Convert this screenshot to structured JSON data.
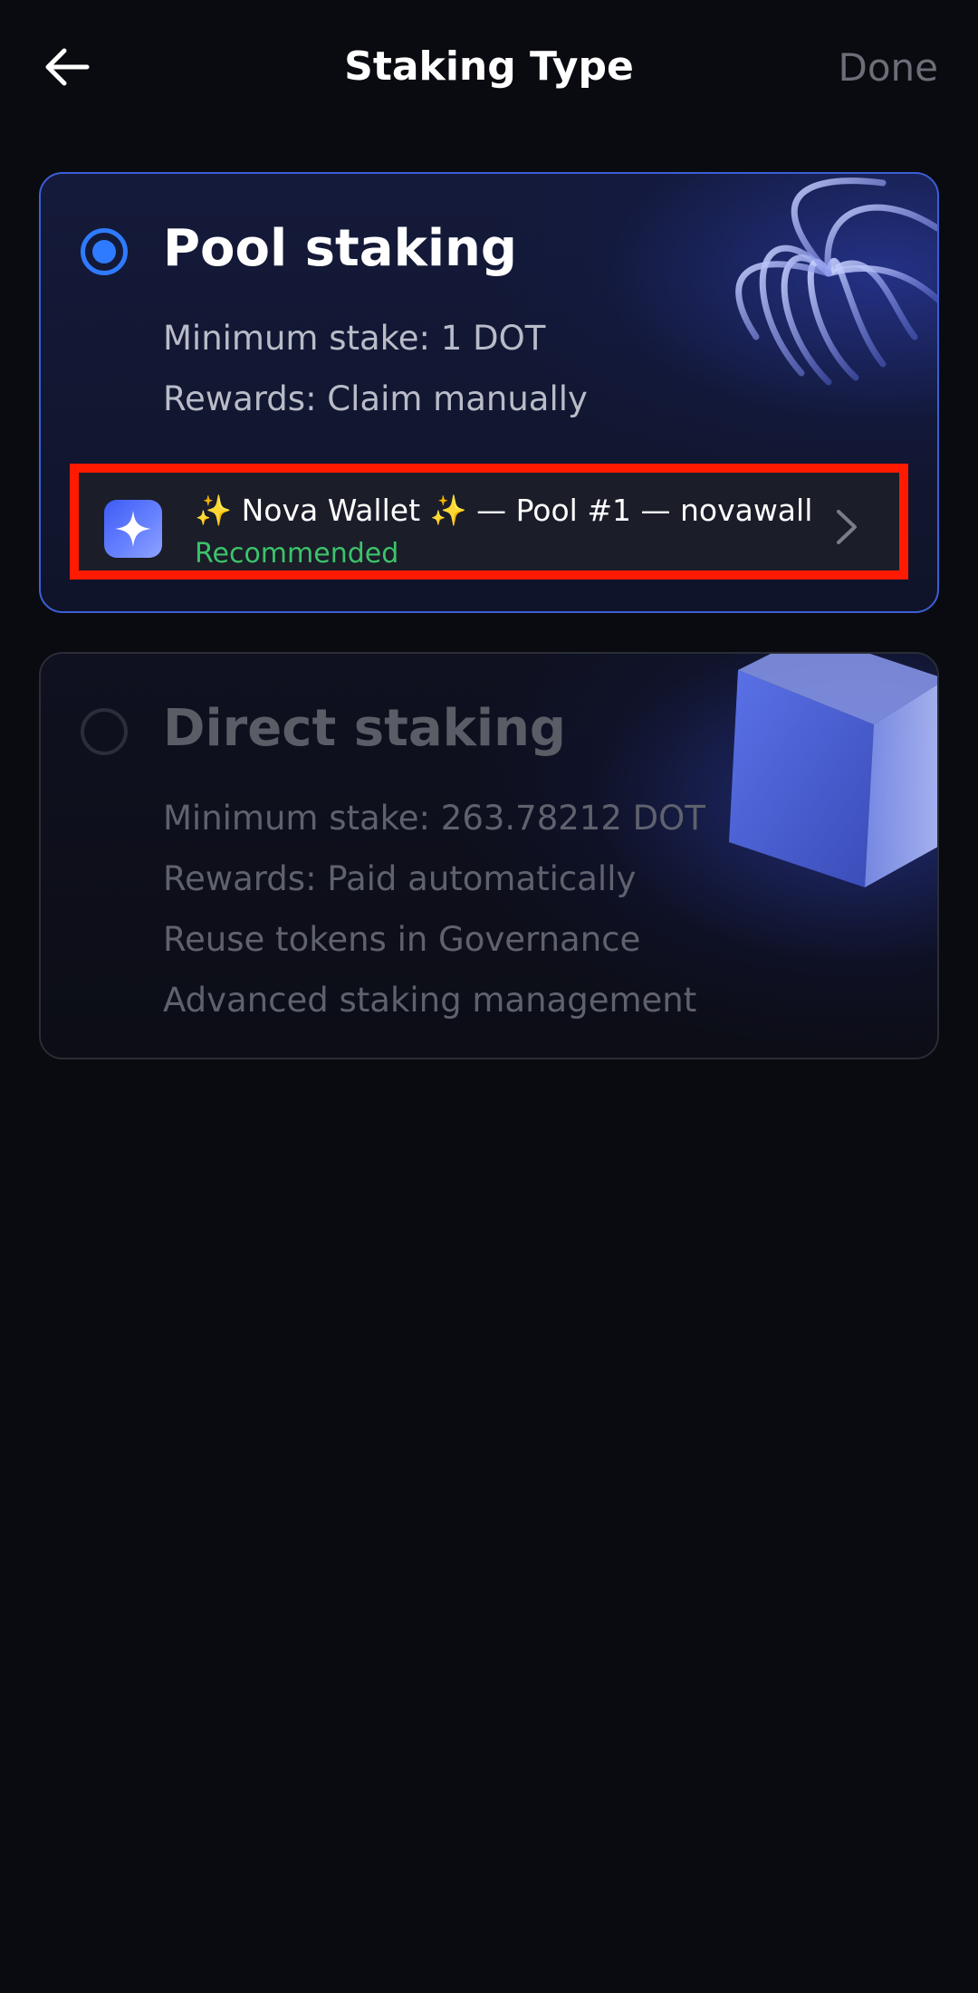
{
  "header": {
    "title": "Staking Type",
    "done_label": "Done",
    "back_icon": "arrow-left-icon"
  },
  "pool_staking": {
    "selected": true,
    "title": "Pool staking",
    "features": [
      "Minimum stake: 1 DOT",
      "Rewards: Claim manually"
    ],
    "selected_pool": {
      "name": "✨ Nova Wallet ✨ — Pool #1 — novawall...",
      "badge": "Recommended",
      "icon": "nova-wallet-logo-icon",
      "chevron_icon": "chevron-right-icon"
    }
  },
  "direct_staking": {
    "selected": false,
    "title": "Direct staking",
    "features": [
      "Minimum stake: 263.78212 DOT",
      "Rewards: Paid automatically",
      "Reuse tokens in Governance",
      "Advanced staking management"
    ]
  },
  "colors": {
    "accent": "#2f7bff",
    "recommended": "#3cc36a",
    "highlight_border": "#ff1a00",
    "background": "#0a0b10"
  }
}
